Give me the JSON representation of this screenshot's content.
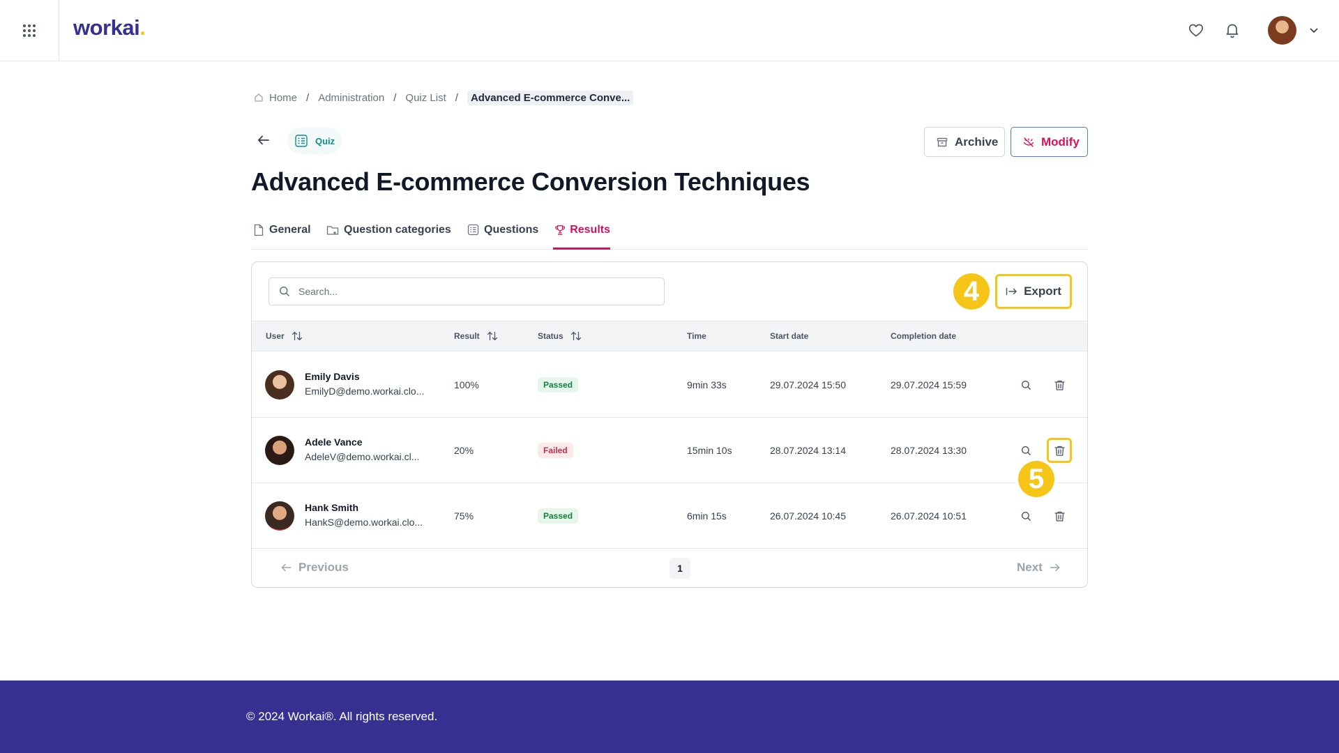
{
  "header": {
    "logo_text": "workai",
    "logo_dot": ".",
    "icons": [
      "apps-grid-icon",
      "heart-icon",
      "bell-icon",
      "chevron-down-icon"
    ]
  },
  "breadcrumb": {
    "items": [
      "Home",
      "Administration",
      "Quiz List",
      "Advanced E-commerce Conve..."
    ],
    "separator": "/"
  },
  "page": {
    "type_badge": "Quiz",
    "title": "Advanced E-commerce Conversion Techniques",
    "archive_label": "Archive",
    "modify_label": "Modify"
  },
  "tabs": [
    {
      "label": "General",
      "active": false
    },
    {
      "label": "Question categories",
      "active": false
    },
    {
      "label": "Questions",
      "active": false
    },
    {
      "label": "Results",
      "active": true
    }
  ],
  "results": {
    "search_placeholder": "Search...",
    "export_label": "Export",
    "step_markers": [
      "4",
      "5"
    ],
    "columns": [
      "User",
      "Result",
      "Status",
      "Time",
      "Start date",
      "Completion date"
    ],
    "rows": [
      {
        "name": "Emily Davis",
        "email": "EmilyD@demo.workai.clo...",
        "result": "100%",
        "status": "Passed",
        "time": "9min 33s",
        "start": "29.07.2024 15:50",
        "completion": "29.07.2024 15:59"
      },
      {
        "name": "Adele Vance",
        "email": "AdeleV@demo.workai.cl...",
        "result": "20%",
        "status": "Failed",
        "time": "15min 10s",
        "start": "28.07.2024 13:14",
        "completion": "28.07.2024 13:30"
      },
      {
        "name": "Hank Smith",
        "email": "HankS@demo.workai.clo...",
        "result": "75%",
        "status": "Passed",
        "time": "6min 15s",
        "start": "26.07.2024 10:45",
        "completion": "26.07.2024 10:51"
      }
    ],
    "pagination": {
      "previous": "Previous",
      "next": "Next",
      "current_page": "1"
    }
  },
  "footer": {
    "text": "© 2024 Workai®. All rights reserved."
  },
  "colors": {
    "brand": "#363190",
    "accent": "#d3115c",
    "highlight": "#f5c518",
    "passed": "#15803d",
    "failed": "#c0324a"
  }
}
